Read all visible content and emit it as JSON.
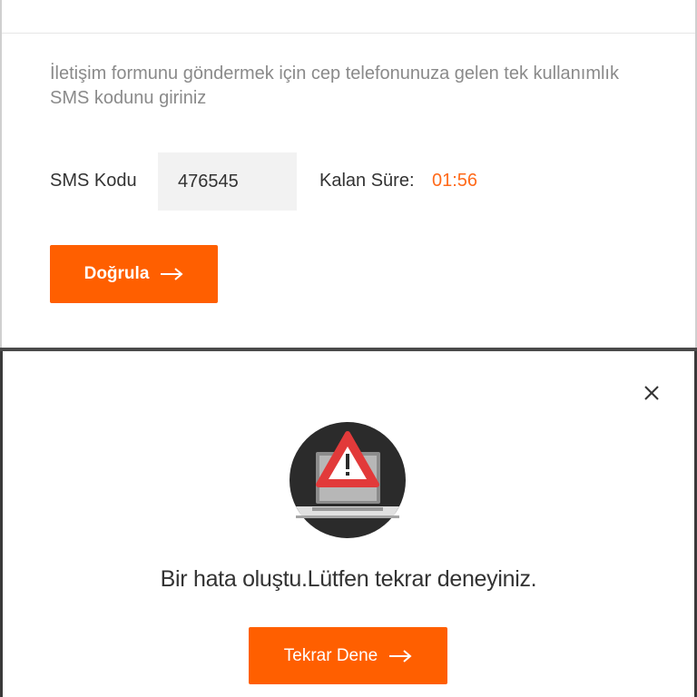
{
  "sms_form": {
    "instruction": "İletişim formunu göndermek için cep telefonunuza gelen tek kullanımlık SMS kodunu giriniz",
    "sms_label": "SMS Kodu",
    "sms_value": "476545",
    "remaining_label": "Kalan Süre:",
    "remaining_time": "01:56",
    "verify_button": "Doğrula",
    "verify_icon": "arrow-right-icon"
  },
  "error_modal": {
    "close_icon": "close-icon",
    "illustration_icon": "laptop-warning-icon",
    "message": "Bir hata oluştu.Lütfen tekrar deneyiniz.",
    "retry_button": "Tekrar Dene",
    "retry_icon": "arrow-right-icon"
  },
  "colors": {
    "accent": "#ff5f00",
    "timer": "#ff6a1a",
    "warning_red": "#e23a3a",
    "illustration_bg": "#2b2b2b"
  }
}
